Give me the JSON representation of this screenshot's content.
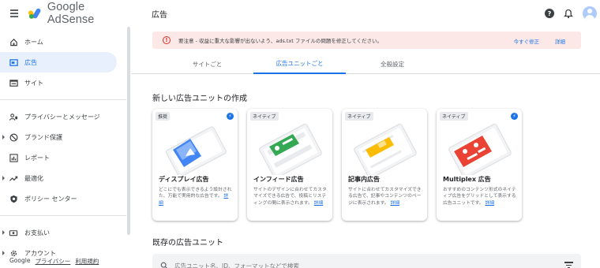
{
  "brand": {
    "name": "Google AdSense"
  },
  "header": {
    "title": "広告"
  },
  "sidebar": {
    "items": [
      {
        "label": "ホーム",
        "icon": "home-icon"
      },
      {
        "label": "広告",
        "icon": "ads-icon",
        "active": true
      },
      {
        "label": "サイト",
        "icon": "sites-icon"
      },
      {
        "label": "プライバシーとメッセージ",
        "icon": "privacy-icon"
      },
      {
        "label": "ブランド保護",
        "icon": "brand-safety-icon",
        "expandable": true
      },
      {
        "label": "レポート",
        "icon": "reports-icon"
      },
      {
        "label": "最適化",
        "icon": "optimization-icon",
        "expandable": true
      },
      {
        "label": "ポリシー センター",
        "icon": "policy-center-icon"
      },
      {
        "label": "お支払い",
        "icon": "payments-icon",
        "expandable": true
      },
      {
        "label": "アカウント",
        "icon": "account-icon",
        "expandable": true
      }
    ],
    "footer": {
      "google": "Google",
      "privacy": "プライバシー",
      "terms": "利用規約"
    }
  },
  "alert": {
    "message": "要注意 - 収益に重大な影響が出ないよう、ads.txt ファイルの問題を修正してください。",
    "fix_label": "今すぐ修正",
    "details_label": "詳細"
  },
  "tabs": [
    {
      "label": "サイトごと"
    },
    {
      "label": "広告ユニットごと",
      "active": true
    },
    {
      "label": "全般設定"
    }
  ],
  "new_units": {
    "title": "新しい広告ユニットの作成",
    "cards": [
      {
        "tag": "推奨",
        "title": "ディスプレイ広告",
        "desc": "どこにでも表示できるよう設計された、万能で実用的な広告です。",
        "link": "詳細",
        "bolt": true
      },
      {
        "tag": "ネイティブ",
        "title": "インフィード広告",
        "desc": "サイトのデザインに合わせてカスタマイズできる広告で、投稿とリスティングの間に表示されます。",
        "link": "詳細",
        "bolt": false
      },
      {
        "tag": "ネイティブ",
        "title": "記事内広告",
        "desc": "サイトに合わせてカスタマイズできる広告で、記事やコンテンツのページに表示されます。",
        "link": "詳細",
        "bolt": false
      },
      {
        "tag": "ネイティブ",
        "title": "Multiplex 広告",
        "desc": "おすすめのコンテンツ形式のネイティブ広告をグリッドとして表示する広告ユニットです。",
        "link": "詳細",
        "bolt": true
      }
    ]
  },
  "existing_units": {
    "title": "既存の広告ユニット",
    "search_placeholder": "広告ユニット名、ID、フォーマットなどで検索"
  },
  "colors": {
    "accent": "#1a73e8",
    "alert_bg": "#fce8e6",
    "alert_icon": "#d93025",
    "active_nav_bg": "#e8f0fe"
  }
}
